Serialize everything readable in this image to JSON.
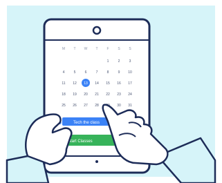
{
  "colors": {
    "background": "#d6f4f9",
    "outline": "#1d2c58",
    "accent": "#3b82f6",
    "event_green": "#37b35a",
    "skin": "#ffffff",
    "sleeve": "#d6f4f9"
  },
  "calendar": {
    "weekday_headers": [
      "M",
      "T",
      "W",
      "T",
      "F",
      "S",
      "S"
    ],
    "rows": [
      {
        "week": "",
        "days": [
          "",
          "",
          "",
          "",
          "1",
          "2",
          "3"
        ]
      },
      {
        "week": "",
        "days": [
          "4",
          "5",
          "6",
          "7",
          "8",
          "9",
          "10"
        ]
      },
      {
        "week": "",
        "days": [
          "11",
          "12",
          "13",
          "14",
          "15",
          "16",
          "17"
        ]
      },
      {
        "week": "",
        "days": [
          "18",
          "19",
          "20",
          "21",
          "22",
          "23",
          "24"
        ]
      },
      {
        "week": "",
        "days": [
          "25",
          "26",
          "27",
          "28",
          "29",
          "30",
          "31"
        ]
      }
    ],
    "selected_day": "13"
  },
  "agenda": {
    "date_number": "13",
    "event_blue_label": "Tech the class",
    "event_green_label": "Start Classes"
  },
  "icons": {
    "camera": "camera-icon",
    "home": "home-indicator-icon"
  }
}
